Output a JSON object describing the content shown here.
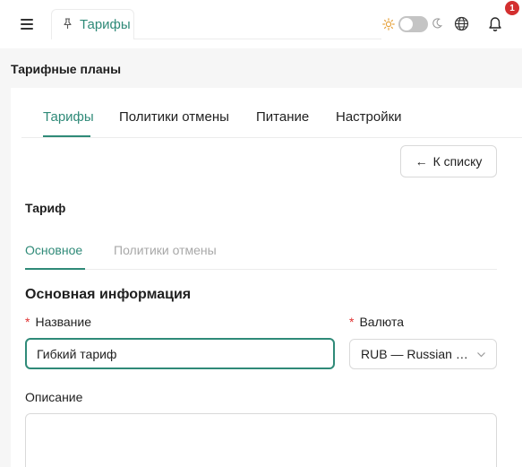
{
  "header": {
    "open_tab": {
      "icon": "pin-icon",
      "label": "Тарифы"
    },
    "theme_toggle": {
      "state": "light"
    },
    "notifications": {
      "count": "1"
    }
  },
  "page": {
    "title": "Тарифные планы"
  },
  "main_tabs": [
    {
      "label": "Тарифы",
      "active": true
    },
    {
      "label": "Политики отмены",
      "active": false
    },
    {
      "label": "Питание",
      "active": false
    },
    {
      "label": "Настройки",
      "active": false
    }
  ],
  "back_button": {
    "arrow": "←",
    "label": "К списку"
  },
  "form": {
    "section_title": "Тариф",
    "sub_tabs": [
      {
        "label": "Основное",
        "active": true
      },
      {
        "label": "Политики отмены",
        "active": false
      }
    ],
    "info_title": "Основная информация",
    "name": {
      "required_mark": "*",
      "label": "Название",
      "value": "Гибкий тариф"
    },
    "currency": {
      "required_mark": "*",
      "label": "Валюта",
      "value": "RUB — Russian R..."
    },
    "description": {
      "label": "Описание",
      "value": ""
    }
  },
  "colors": {
    "accent": "#2f8a78",
    "badge": "#d32f2f",
    "required": "#e03131"
  }
}
